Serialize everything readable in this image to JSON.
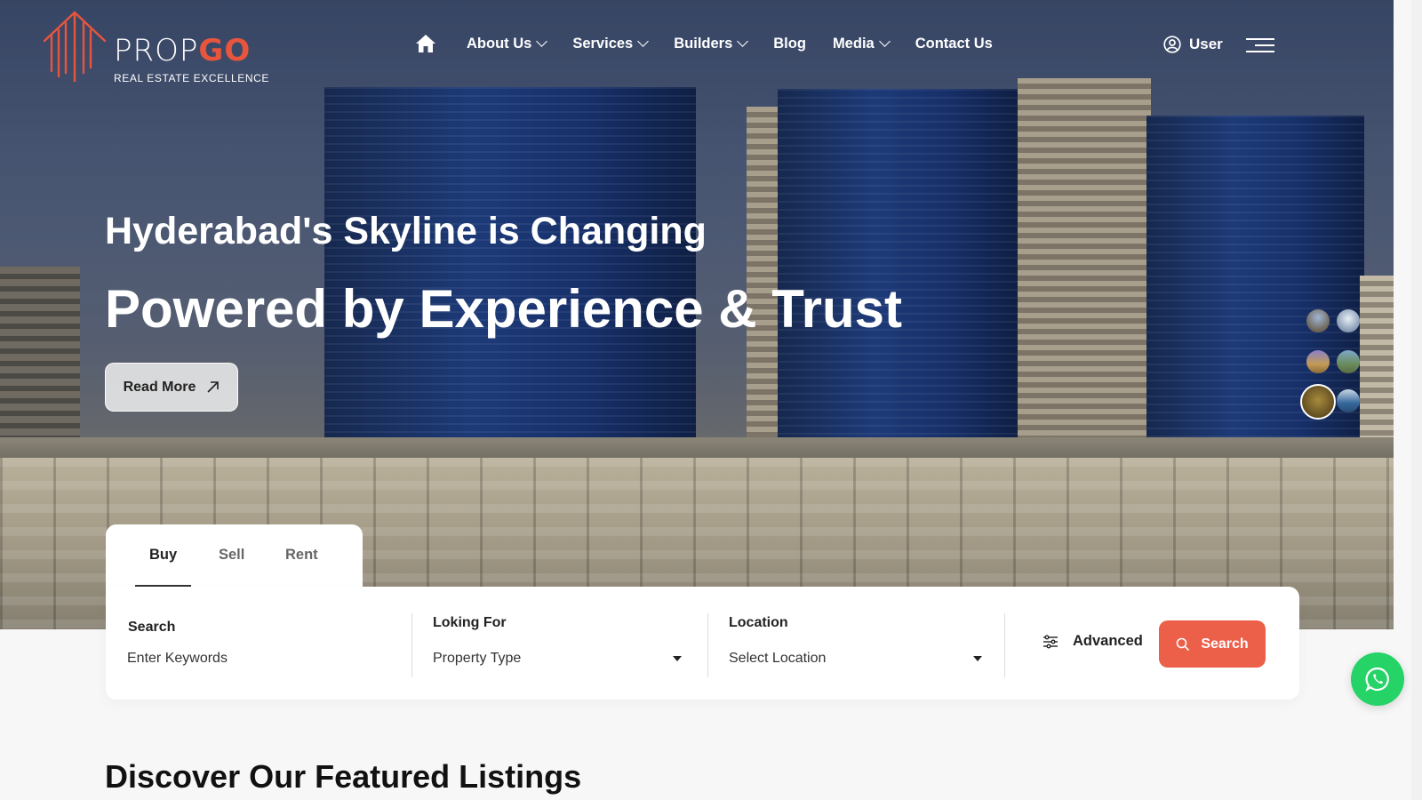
{
  "brand": {
    "name_part1": "PROP",
    "name_part2": "GO",
    "tagline": "REAL ESTATE EXCELLENCE",
    "accent_color": "#e8553d"
  },
  "nav": {
    "home_icon": "home-icon",
    "items": [
      {
        "label": "About Us",
        "dropdown": true
      },
      {
        "label": "Services",
        "dropdown": true
      },
      {
        "label": "Builders",
        "dropdown": true
      },
      {
        "label": "Blog",
        "dropdown": false
      },
      {
        "label": "Media",
        "dropdown": true
      },
      {
        "label": "Contact Us",
        "dropdown": false
      }
    ],
    "user_label": "User",
    "user_icon": "user-circle-icon",
    "menu_icon": "hamburger-menu-icon"
  },
  "hero": {
    "headline_small": "Hyderabad's Skyline is Changing",
    "headline_large": "Powered by Experience & Trust",
    "cta_label": "Read More",
    "cta_icon": "arrow-up-right-icon",
    "thumbnails_count": 6,
    "active_thumbnail_index": 4
  },
  "search": {
    "tabs": [
      {
        "label": "Buy",
        "active": true
      },
      {
        "label": "Sell",
        "active": false
      },
      {
        "label": "Rent",
        "active": false
      }
    ],
    "fields": {
      "keywords": {
        "label": "Search",
        "placeholder": "Enter Keywords"
      },
      "looking_for": {
        "label": "Loking For",
        "value": "Property Type"
      },
      "location": {
        "label": "Location",
        "value": "Select Location"
      }
    },
    "advanced_label": "Advanced",
    "advanced_icon": "sliders-icon",
    "search_button_label": "Search",
    "search_button_icon": "search-icon",
    "search_button_color": "#ec5f49"
  },
  "floating": {
    "whatsapp_icon": "whatsapp-icon",
    "whatsapp_color": "#25d366"
  },
  "featured": {
    "title": "Discover Our Featured Listings"
  }
}
